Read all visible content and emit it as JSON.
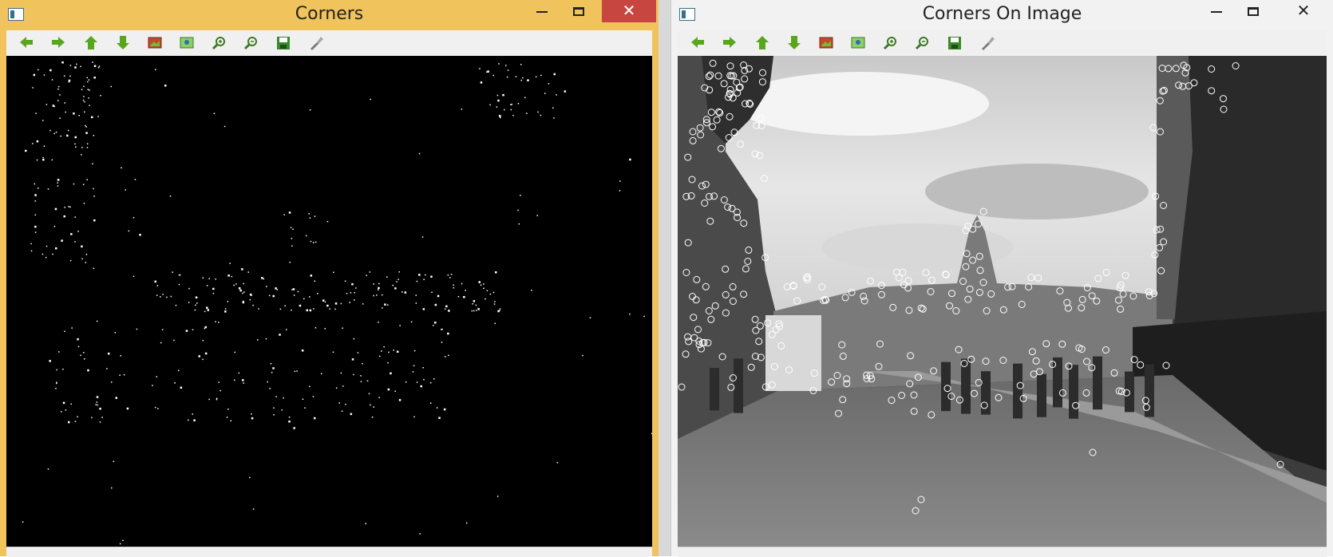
{
  "left_window": {
    "title": "Corners",
    "sys_icon": "window-app-icon",
    "controls": {
      "minimize": "minimize-icon",
      "maximize": "maximize-icon",
      "close": "close-icon"
    },
    "close_glyph": "✕"
  },
  "right_window": {
    "title": "Corners On Image",
    "sys_icon": "window-app-icon",
    "controls": {
      "minimize": "minimize-icon",
      "maximize": "maximize-icon",
      "close": "close-icon"
    },
    "close_glyph": "✕"
  },
  "toolbar": {
    "buttons": [
      {
        "icon": "pan-left-icon"
      },
      {
        "icon": "pan-right-icon"
      },
      {
        "icon": "pan-up-icon"
      },
      {
        "icon": "pan-down-icon"
      },
      {
        "icon": "zoom-fit-image-icon"
      },
      {
        "icon": "zoom-original-icon"
      },
      {
        "icon": "zoom-in-icon"
      },
      {
        "icon": "zoom-out-icon"
      },
      {
        "icon": "save-icon"
      },
      {
        "icon": "properties-icon"
      }
    ]
  },
  "colors": {
    "active_titlebar": "#f0c35c",
    "inactive_titlebar": "#f2f2f2",
    "close_button": "#c7463f",
    "toolbar_arrow": "#5aa51e",
    "left_canvas": "#000000",
    "corner_marker": "#ffffff"
  }
}
